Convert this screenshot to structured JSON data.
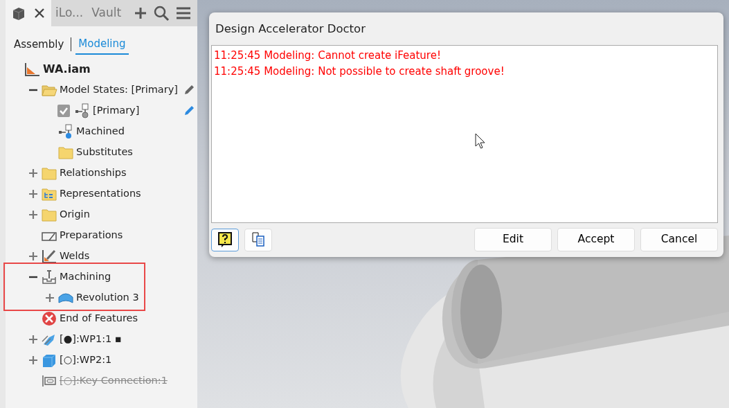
{
  "panel": {
    "top_tabs": [
      {
        "label": "iLo...",
        "kind": "text"
      },
      {
        "label": "Vault",
        "kind": "text"
      }
    ],
    "view_tabs": [
      {
        "label": "Assembly",
        "selected": false
      },
      {
        "label": "Modeling",
        "selected": true
      }
    ],
    "tree": [
      {
        "label": "WA.iam",
        "kind": "assembly",
        "bold": true,
        "children": [
          {
            "label": "Model States: [Primary]",
            "kind": "folder-open",
            "expanded": true,
            "edit_active": false,
            "children": [
              {
                "label": "[Primary]",
                "kind": "model-state",
                "checked": true,
                "edit_active": true
              },
              {
                "label": "Machined",
                "kind": "model-state-blue"
              },
              {
                "label": "Substitutes",
                "kind": "folder"
              }
            ]
          },
          {
            "label": "Relationships",
            "kind": "folder",
            "expanded": false
          },
          {
            "label": "Representations",
            "kind": "folder-rep",
            "expanded": false
          },
          {
            "label": "Origin",
            "kind": "folder",
            "expanded": false
          },
          {
            "label": "Preparations",
            "kind": "preparations"
          },
          {
            "label": "Welds",
            "kind": "welds",
            "expanded": false
          },
          {
            "label": "Machining",
            "kind": "machining",
            "expanded": true,
            "highlighted": true,
            "children": [
              {
                "label": "Revolution 3",
                "kind": "revolution",
                "expanded": false
              }
            ]
          },
          {
            "label": "End of Features",
            "kind": "end"
          },
          {
            "label": "[●]:WP1:1 ▪",
            "kind": "part-arrow",
            "expanded": false
          },
          {
            "label": "[○]:WP2:1",
            "kind": "part-box",
            "expanded": false
          },
          {
            "label": "[○]:Key Connection:1",
            "kind": "key-connection",
            "suppressed": true
          }
        ]
      }
    ]
  },
  "dialog": {
    "title": "Design Accelerator Doctor",
    "messages": [
      "11:25:45 Modeling: Cannot create iFeature!",
      "11:25:45 Modeling: Not possible to create shaft groove!"
    ],
    "tool_buttons": [
      {
        "kind": "help",
        "pressed": true
      },
      {
        "kind": "copy",
        "pressed": false
      }
    ],
    "buttons": [
      "Edit",
      "Accept",
      "Cancel"
    ]
  }
}
